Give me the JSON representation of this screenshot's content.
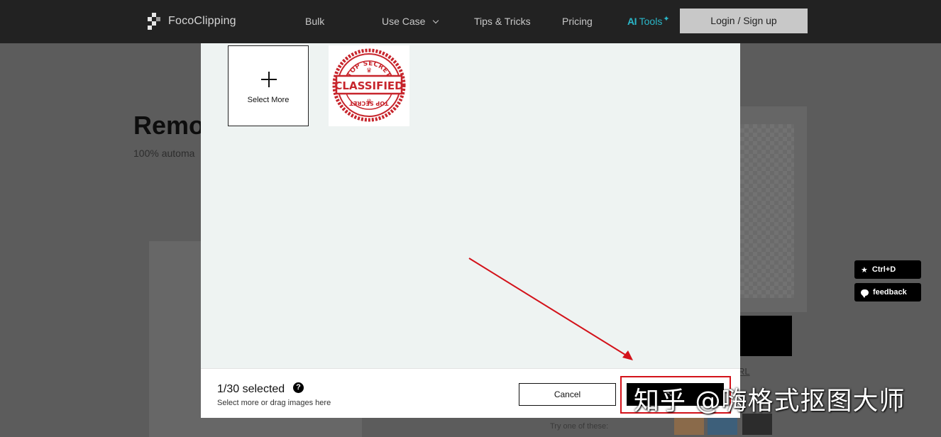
{
  "nav": {
    "logo_text": "FocoClipping",
    "items": [
      {
        "label": "Bulk"
      },
      {
        "label": "Use Case"
      },
      {
        "label": "Tips & Tricks"
      },
      {
        "label": "Pricing"
      }
    ],
    "ai_tools": {
      "prefix": "AI",
      "label": "Tools"
    },
    "login_label": "Login / Sign up"
  },
  "background": {
    "hero_title": "Remo",
    "hero_subtitle": "100% automa",
    "url_link": "RL",
    "try_text": "Try one of these:"
  },
  "side_buttons": {
    "bookmark_label": "Ctrl+D",
    "feedback_label": "feedback"
  },
  "modal": {
    "select_more_label": "Select More",
    "thumbnail": {
      "top_text": "TOP SECRET",
      "main_text": "CLASSIFIED",
      "bottom_text": "TOP SECRET",
      "color": "#c7252c"
    },
    "selected_count": "1/30 selected",
    "help_icon": "?",
    "hint": "Select more or drag images here",
    "cancel_label": "Cancel"
  },
  "annotation": {
    "color": "#d3121a"
  },
  "watermark": "知乎 @嗨格式抠图大师"
}
